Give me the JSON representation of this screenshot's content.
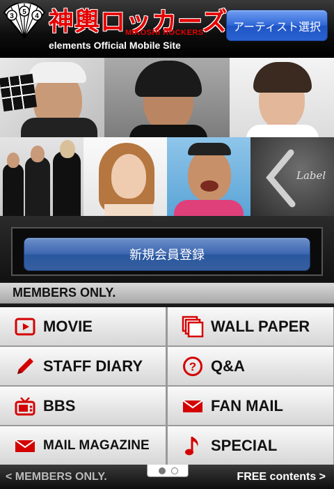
{
  "header": {
    "logo_title": "神輿ロッカーズ",
    "logo_sub": "MIKOSHI ROCKERS",
    "fan_numbers": [
      "3",
      "5",
      "4"
    ],
    "tagline": "elements Official Mobile Site",
    "artist_button": "アーティスト選択"
  },
  "photos": {
    "label_text": "Label"
  },
  "register_button": "新規会員登録",
  "members_label": "MEMBERS ONLY.",
  "menu": {
    "items": [
      {
        "label": "MOVIE",
        "icon": "play-icon"
      },
      {
        "label": "WALL PAPER",
        "icon": "wallpaper-icon"
      },
      {
        "label": "STAFF DIARY",
        "icon": "pencil-icon"
      },
      {
        "label": "Q&A",
        "icon": "question-icon"
      },
      {
        "label": "BBS",
        "icon": "tv-icon"
      },
      {
        "label": "FAN MAIL",
        "icon": "envelope-icon"
      },
      {
        "label": "MAIL MAGAZINE",
        "icon": "envelope-icon"
      },
      {
        "label": "SPECIAL",
        "icon": "music-note-icon"
      }
    ]
  },
  "footer": {
    "left": "< MEMBERS ONLY.",
    "right": "FREE contents >"
  },
  "colors": {
    "brand_red": "#e60000",
    "button_blue": "#2f67d8",
    "icon_red": "#d40000"
  }
}
